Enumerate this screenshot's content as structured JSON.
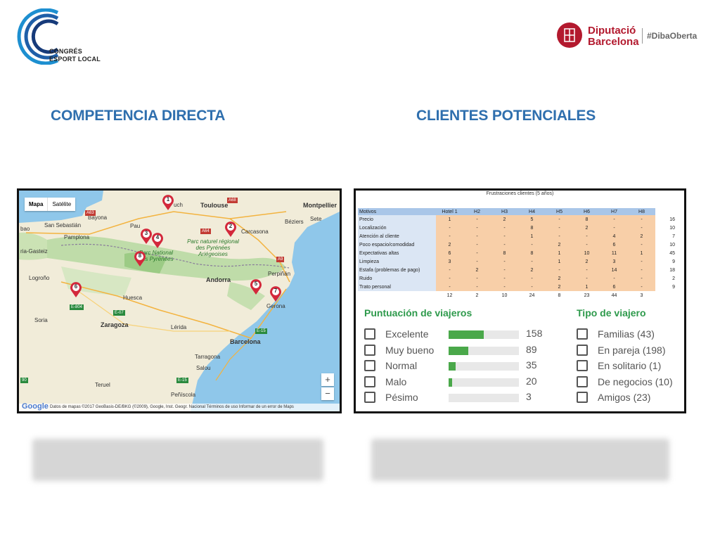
{
  "header": {
    "logo_line1": "CONGRÉS",
    "logo_line2": "ESPORT LOCAL",
    "diba_line1": "Diputació",
    "diba_line2": "Barcelona",
    "hashtag": "#DibaOberta"
  },
  "sections": {
    "left_title": "COMPETENCIA DIRECTA",
    "right_title": "CLIENTES POTENCIALES"
  },
  "map": {
    "mode_map": "Mapa",
    "mode_satellite": "Satélite",
    "zoom_in": "+",
    "zoom_out": "−",
    "google": "Google",
    "attribution": "Datos de mapas ©2017 GeoBasis-DE/BKG (©2009), Google, Inst. Geogr. Nacional   Términos de uso   Informar de un error de Maps",
    "places": {
      "toulouse": "Toulouse",
      "montpellier": "Montpellier",
      "bayonne": "Bayona",
      "auch": "uch",
      "san_sebastian": "San Sebastián",
      "bilbao": "bao",
      "pau": "Pau",
      "beziers": "Béziers",
      "sete": "Sete",
      "carcasona": "Carcasona",
      "vitoria": "ria-Gasteiz",
      "pamplona": "Pamplona",
      "park": "Parc naturel régional des Pyrénées Ariégeoises",
      "pyrenees_nat": "Parc National des Pyrénées",
      "perpinan": "Perpiñán",
      "logrono": "Logroño",
      "andorra": "Andorra",
      "huesca": "Huesca",
      "girona": "Gerona",
      "zaragoza": "Zaragoza",
      "lleida": "Lérida",
      "soria": "Soria",
      "barcelona": "Barcelona",
      "tarragona": "Tarragona",
      "salou": "Salou",
      "teruel": "Teruel",
      "peniscola": "Peñíscola"
    },
    "roads": [
      "A63",
      "A64",
      "A68",
      "A9",
      "E-804",
      "E-07",
      "E-15",
      "E-15",
      "90"
    ],
    "pins": [
      "1",
      "2",
      "3",
      "4",
      "5",
      "6",
      "7",
      "8"
    ]
  },
  "frustrations": {
    "title": "Frustraciones clientes (5 años)",
    "columns": [
      "Motivos",
      "Hotel 1",
      "H2",
      "H3",
      "H4",
      "H5",
      "H6",
      "H7",
      "H8"
    ],
    "rows": [
      {
        "label": "Precio",
        "values": [
          "1",
          "-",
          "2",
          "5",
          "-",
          "8",
          "-",
          "-"
        ],
        "total": "16"
      },
      {
        "label": "Localización",
        "values": [
          "-",
          "-",
          "-",
          "8",
          "-",
          "2",
          "-",
          "-"
        ],
        "total": "10"
      },
      {
        "label": "Atención al cliente",
        "values": [
          "-",
          "-",
          "-",
          "1",
          "-",
          "-",
          "4",
          "2"
        ],
        "total": "7"
      },
      {
        "label": "Poco espacio/comodidad",
        "values": [
          "2",
          "-",
          "-",
          "-",
          "2",
          "-",
          "6",
          "-"
        ],
        "total": "10"
      },
      {
        "label": "Expectativas altas",
        "values": [
          "6",
          "-",
          "8",
          "8",
          "1",
          "10",
          "11",
          "1"
        ],
        "total": "45"
      },
      {
        "label": "Limpieza",
        "values": [
          "3",
          "-",
          "-",
          "-",
          "1",
          "2",
          "3",
          "-"
        ],
        "total": "9"
      },
      {
        "label": "Estafa (problemas de pago)",
        "values": [
          "-",
          "2",
          "-",
          "2",
          "-",
          "-",
          "14",
          "-"
        ],
        "total": "18"
      },
      {
        "label": "Ruido",
        "values": [
          "-",
          "-",
          "-",
          "-",
          "2",
          "-",
          "-",
          "-"
        ],
        "total": "2"
      },
      {
        "label": "Trato personal",
        "values": [
          "-",
          "-",
          "-",
          "-",
          "2",
          "1",
          "6",
          "-"
        ],
        "total": "9"
      }
    ],
    "column_totals": [
      "12",
      "2",
      "10",
      "24",
      "8",
      "23",
      "44",
      "3"
    ]
  },
  "reviews": {
    "title": "Puntuación de viajeros",
    "items": [
      {
        "label": "Excelente",
        "count": "158",
        "fraction": 0.5
      },
      {
        "label": "Muy bueno",
        "count": "89",
        "fraction": 0.28
      },
      {
        "label": "Normal",
        "count": "35",
        "fraction": 0.1
      },
      {
        "label": "Malo",
        "count": "20",
        "fraction": 0.05
      },
      {
        "label": "Pésimo",
        "count": "3",
        "fraction": 0.0
      }
    ]
  },
  "traveler_type": {
    "title": "Tipo de viajero",
    "items": [
      "Familias (43)",
      "En pareja (198)",
      "En solitario (1)",
      "De negocios (10)",
      "Amigos (23)"
    ]
  },
  "colors": {
    "title_blue": "#2f6fae",
    "diba_red": "#b3192e",
    "review_green": "#2e9a4c",
    "bar_green": "#4aa84a",
    "table_header": "#a9c6e8",
    "table_cells": "#f8cfa8"
  }
}
